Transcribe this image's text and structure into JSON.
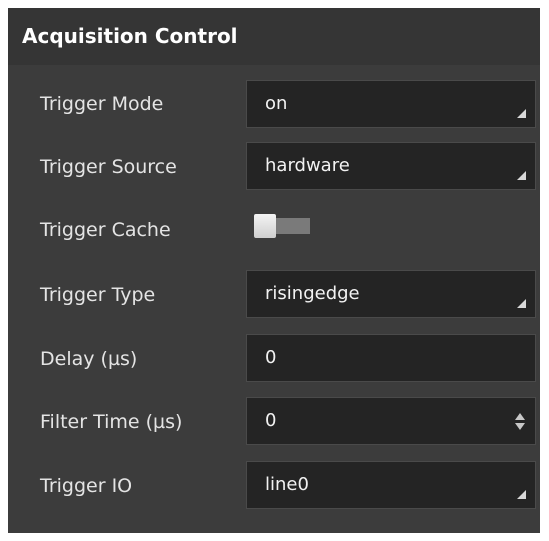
{
  "panel": {
    "title": "Acquisition Control"
  },
  "rows": [
    {
      "label": "Trigger Mode",
      "control": "dropdown",
      "value": "on"
    },
    {
      "label": "Trigger Source",
      "control": "dropdown",
      "value": "hardware"
    },
    {
      "label": "Trigger Cache",
      "control": "toggle",
      "state": "off"
    },
    {
      "label": "Trigger Type",
      "control": "dropdown",
      "value": "risingedge"
    },
    {
      "label": "Delay (µs)",
      "control": "text-input",
      "value": "0"
    },
    {
      "label": "Filter Time (µs)",
      "control": "spinbox",
      "value": "0"
    },
    {
      "label": "Trigger IO",
      "control": "dropdown",
      "value": "line0"
    }
  ],
  "icons": {
    "dropdown": "dropdown-corner-arrow-icon",
    "spinbox": "spin-up-down-icon"
  },
  "colors": {
    "panel_background": "#3c3c3c",
    "header_background": "#353535",
    "field_background": "#242424",
    "text": "#e4e4e4"
  }
}
